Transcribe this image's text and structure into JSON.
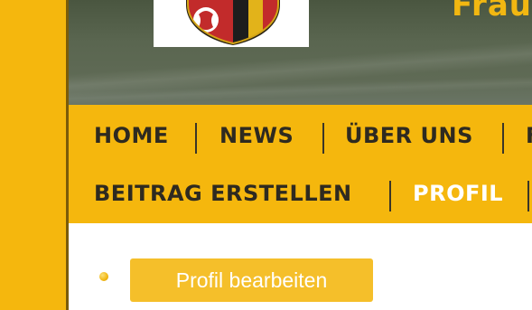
{
  "header": {
    "title_fragment": "Frau"
  },
  "nav": {
    "row1": [
      {
        "label": "HOME"
      },
      {
        "label": "NEWS"
      },
      {
        "label": "ÜBER UNS"
      },
      {
        "label": "F"
      }
    ],
    "row2": [
      {
        "label": "BEITRAG ERSTELLEN"
      },
      {
        "label": "PROFIL",
        "active": true
      }
    ]
  },
  "content": {
    "edit_profile_button": "Profil bearbeiten"
  },
  "colors": {
    "accent": "#f5b70d",
    "button": "#f5bf2a",
    "nav_text": "#2e2a20",
    "active_text": "#ffffff",
    "header_bg": "#55614b"
  }
}
